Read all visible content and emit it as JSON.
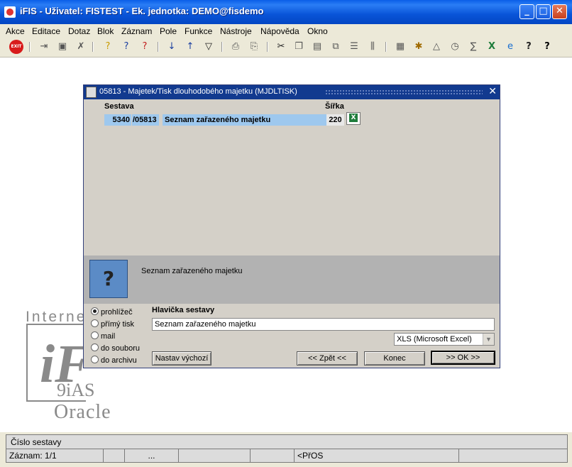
{
  "window": {
    "title": "iFIS - Uživatel: FISTEST - Ek. jednotka: DEMO@fisdemo",
    "min": "_",
    "max": "□",
    "close": "✕"
  },
  "menu": [
    "Akce",
    "Editace",
    "Dotaz",
    "Blok",
    "Záznam",
    "Pole",
    "Funkce",
    "Nástroje",
    "Nápověda",
    "Okno"
  ],
  "toolbar": {
    "exit_label": "EXIT"
  },
  "watermark": {
    "line1": "Internet",
    "line2": "iF",
    "line3": "9iAS",
    "line4": "Oracle"
  },
  "dialog": {
    "title": "05813 - Majetek/Tisk dlouhodobého majetku (MJDLTISK)",
    "close": "✕",
    "col_sestava": "Sestava",
    "col_sirka": "Šířka",
    "row": {
      "num": "5340",
      "code": "/05813",
      "name": "Seznam zařazeného majetku",
      "width": "220"
    },
    "info_text": "Seznam zařazeného majetku",
    "radios": [
      "prohlížeč",
      "přímý tisk",
      "mail",
      "do souboru",
      "do archivu"
    ],
    "header_label": "Hlavička sestavy",
    "header_value": "Seznam zařazeného majetku",
    "format": "XLS (Microsoft Excel)",
    "btn_default": "Nastav výchozí",
    "btn_back": "<< Zpět <<",
    "btn_end": "Konec",
    "btn_ok": ">> OK >>"
  },
  "status": {
    "field_hint": "Číslo sestavy",
    "record": "Záznam: 1/1",
    "ellipsis": "...",
    "mode": "<PřOS"
  }
}
